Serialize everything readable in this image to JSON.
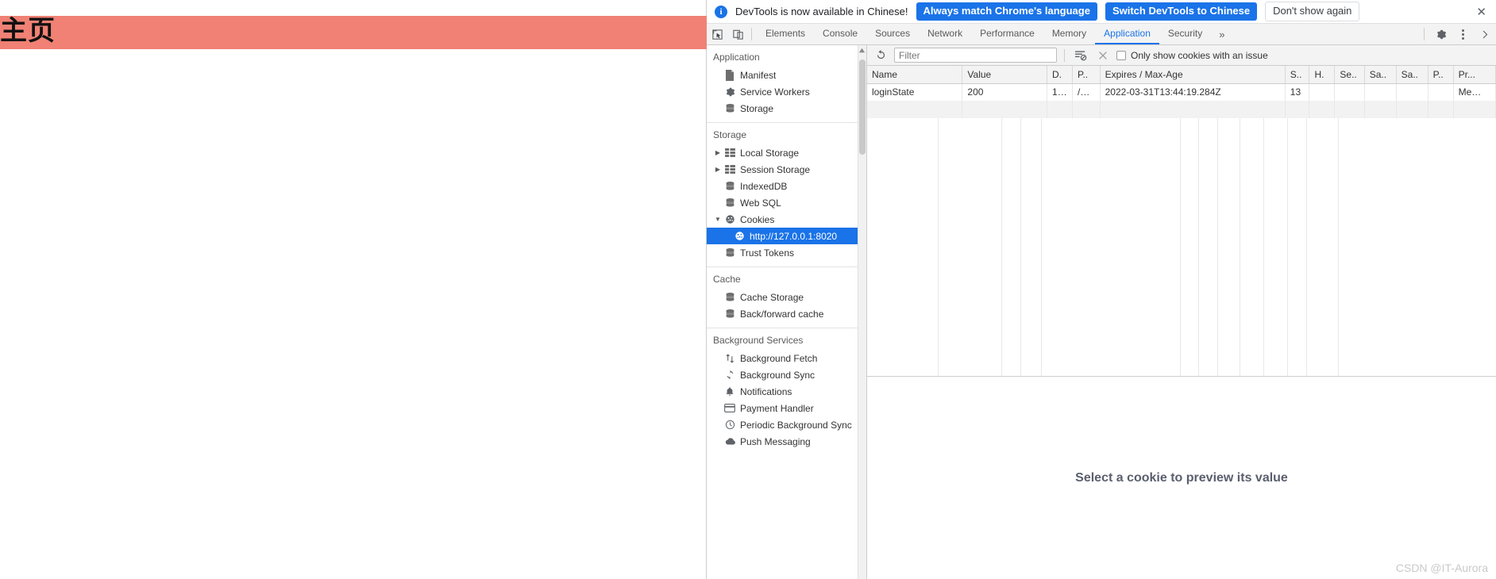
{
  "page": {
    "title": "主页",
    "banner_color": "#f08174"
  },
  "infobar": {
    "icon": "info-icon",
    "message": "DevTools is now available in Chinese!",
    "primary_button": "Always match Chrome's language",
    "secondary_button": "Switch DevTools to Chinese",
    "dismiss_button": "Don't show again",
    "close_icon": "close-icon",
    "accent": "#1a73e8"
  },
  "toolbar": {
    "inspect_icon": "inspect-element-icon",
    "device_icon": "device-toolbar-icon",
    "tabs": [
      {
        "label": "Elements",
        "active": false
      },
      {
        "label": "Console",
        "active": false
      },
      {
        "label": "Sources",
        "active": false
      },
      {
        "label": "Network",
        "active": false
      },
      {
        "label": "Performance",
        "active": false
      },
      {
        "label": "Memory",
        "active": false
      },
      {
        "label": "Application",
        "active": true
      },
      {
        "label": "Security",
        "active": false
      }
    ],
    "more_tabs_icon": "chevron-double-right-icon",
    "settings_icon": "gear-icon",
    "menu_icon": "kebab-menu-icon",
    "close_icon": "close-devtools-icon"
  },
  "sidebar": {
    "sections": [
      {
        "title": "Application",
        "items": [
          {
            "label": "Manifest",
            "icon": "manifest-file-icon",
            "arrow": "none",
            "level": 1,
            "selected": false
          },
          {
            "label": "Service Workers",
            "icon": "gear-icon",
            "arrow": "none",
            "level": 1,
            "selected": false
          },
          {
            "label": "Storage",
            "icon": "database-icon",
            "arrow": "none",
            "level": 1,
            "selected": false
          }
        ]
      },
      {
        "title": "Storage",
        "items": [
          {
            "label": "Local Storage",
            "icon": "table-grid-icon",
            "arrow": "collapsed",
            "level": 1,
            "selected": false
          },
          {
            "label": "Session Storage",
            "icon": "table-grid-icon",
            "arrow": "collapsed",
            "level": 1,
            "selected": false
          },
          {
            "label": "IndexedDB",
            "icon": "database-icon",
            "arrow": "none",
            "level": 1,
            "selected": false
          },
          {
            "label": "Web SQL",
            "icon": "database-icon",
            "arrow": "none",
            "level": 1,
            "selected": false
          },
          {
            "label": "Cookies",
            "icon": "cookie-icon",
            "arrow": "expanded",
            "level": 1,
            "selected": false
          },
          {
            "label": "http://127.0.0.1:8020",
            "icon": "cookie-icon",
            "arrow": "none",
            "level": 2,
            "selected": true
          },
          {
            "label": "Trust Tokens",
            "icon": "database-icon",
            "arrow": "none",
            "level": 1,
            "selected": false
          }
        ]
      },
      {
        "title": "Cache",
        "items": [
          {
            "label": "Cache Storage",
            "icon": "database-icon",
            "arrow": "none",
            "level": 1,
            "selected": false
          },
          {
            "label": "Back/forward cache",
            "icon": "database-icon",
            "arrow": "none",
            "level": 1,
            "selected": false
          }
        ]
      },
      {
        "title": "Background Services",
        "items": [
          {
            "label": "Background Fetch",
            "icon": "updown-arrows-icon",
            "arrow": "none",
            "level": 1,
            "selected": false
          },
          {
            "label": "Background Sync",
            "icon": "sync-icon",
            "arrow": "none",
            "level": 1,
            "selected": false
          },
          {
            "label": "Notifications",
            "icon": "bell-icon",
            "arrow": "none",
            "level": 1,
            "selected": false
          },
          {
            "label": "Payment Handler",
            "icon": "credit-card-icon",
            "arrow": "none",
            "level": 1,
            "selected": false
          },
          {
            "label": "Periodic Background Sync",
            "icon": "clock-icon",
            "arrow": "none",
            "level": 1,
            "selected": false
          },
          {
            "label": "Push Messaging",
            "icon": "cloud-icon",
            "arrow": "none",
            "level": 1,
            "selected": false
          }
        ]
      }
    ],
    "scrollbar": "vertical-scrollbar"
  },
  "cookie_panel": {
    "refresh_icon": "refresh-icon",
    "filter_placeholder": "Filter",
    "filter_value": "",
    "clear_filtered_icon": "clear-filtered-cookies-icon",
    "clear_all_icon": "clear-all-cookies-icon",
    "only_issues_label": "Only show cookies with an issue",
    "only_issues_checked": false,
    "columns": [
      "Name",
      "Value",
      "D.",
      "P..",
      "Expires / Max-Age",
      "S..",
      "H.",
      "Se..",
      "Sa..",
      "Sa..",
      "P..",
      "Pr..."
    ],
    "rows": [
      {
        "name": "loginState",
        "value": "200",
        "domain": "1…",
        "path": "/…",
        "expires": "2022-03-31T13:44:19.284Z",
        "size": "13",
        "httponly": "",
        "secure": "",
        "samesite": "",
        "samesite2": "",
        "partition": "",
        "priority": "Me…"
      }
    ],
    "preview_message": "Select a cookie to preview its value"
  },
  "watermark": "CSDN @IT-Aurora"
}
